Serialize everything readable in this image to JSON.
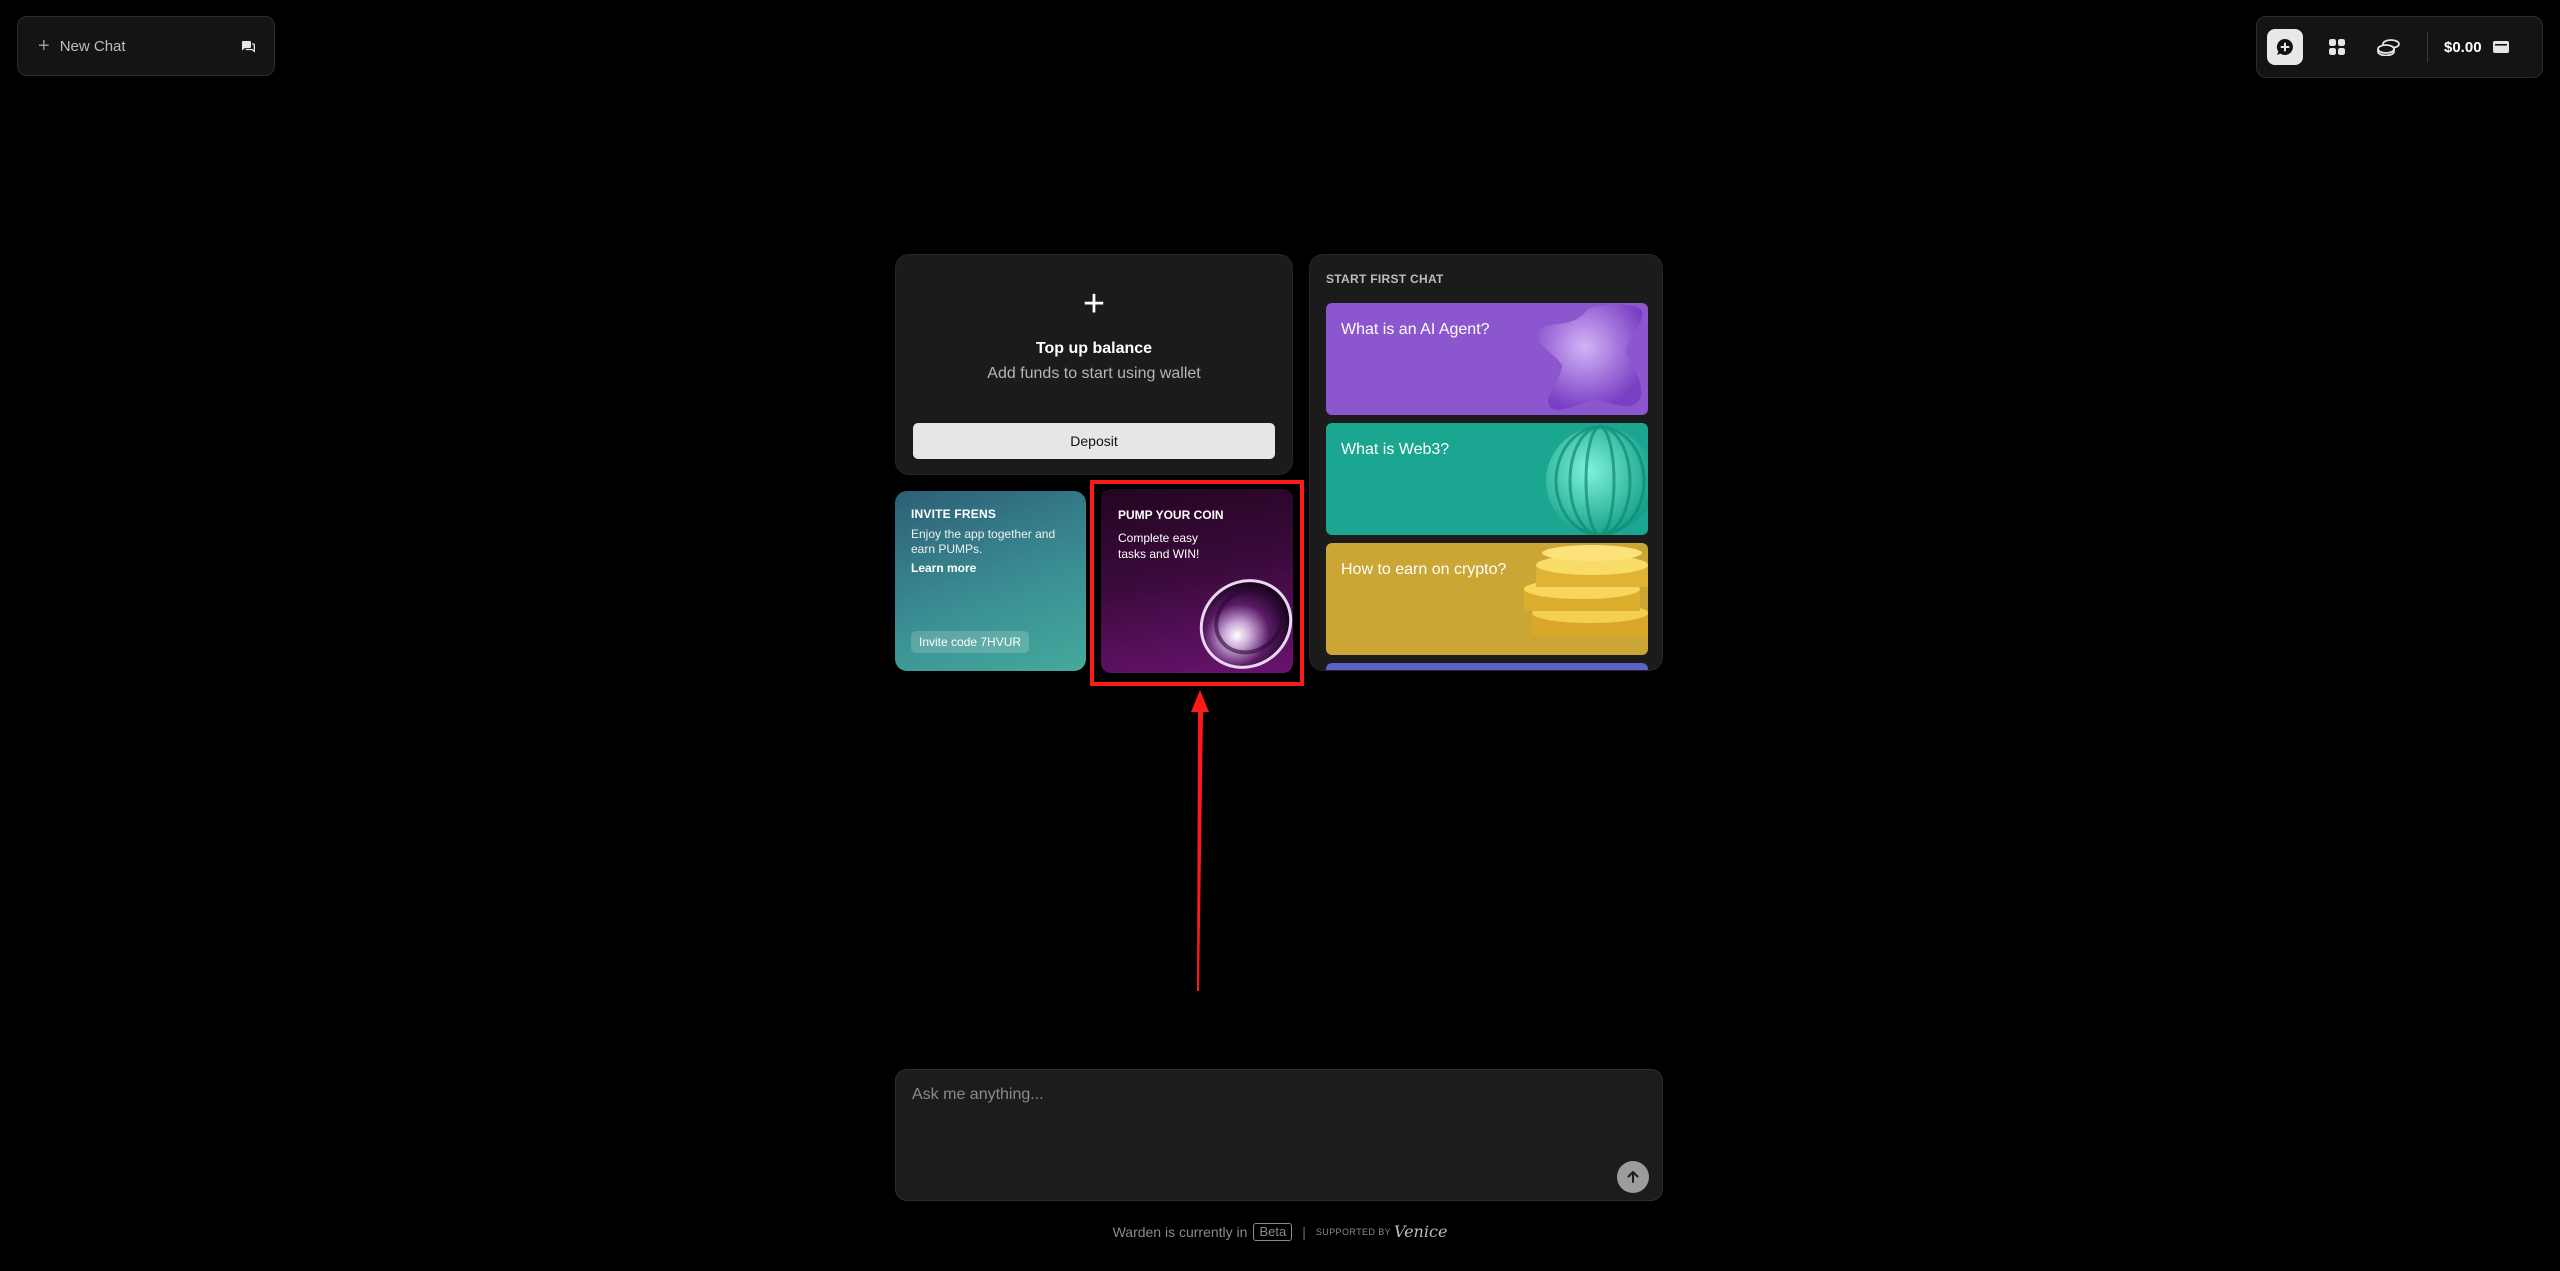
{
  "sidebar": {
    "new_chat_label": "New Chat"
  },
  "toolbar": {
    "balance": "$0.00",
    "icons": [
      "chat-plus-icon",
      "apps-grid-icon",
      "coins-icon",
      "wallet-icon"
    ]
  },
  "topup": {
    "title": "Top up balance",
    "subtitle": "Add funds to start using wallet",
    "deposit_label": "Deposit"
  },
  "invite": {
    "heading": "INVITE FRENS",
    "description": "Enjoy the app together and earn PUMPs.",
    "learn_more": "Learn more",
    "code": "Invite code 7HVUR"
  },
  "pump": {
    "heading": "PUMP YOUR COIN",
    "description": "Complete easy tasks and WIN!"
  },
  "start_chat": {
    "title": "START FIRST CHAT",
    "prompts": [
      {
        "label": "What is an AI Agent?",
        "color": "#8c56cf"
      },
      {
        "label": "What is Web3?",
        "color": "#1aa690"
      },
      {
        "label": "How to earn on crypto?",
        "color": "#cba635"
      }
    ],
    "next_color": "#5b63c9"
  },
  "chat_input": {
    "placeholder": "Ask me anything..."
  },
  "footer": {
    "status_text": "Warden is currently in",
    "badge": "Beta",
    "supported_by": "SUPPORTED BY",
    "partner": "Venice"
  },
  "colors": {
    "background": "#000000",
    "panel": "#1b1b1b",
    "annotation": "#ff1a1a"
  }
}
